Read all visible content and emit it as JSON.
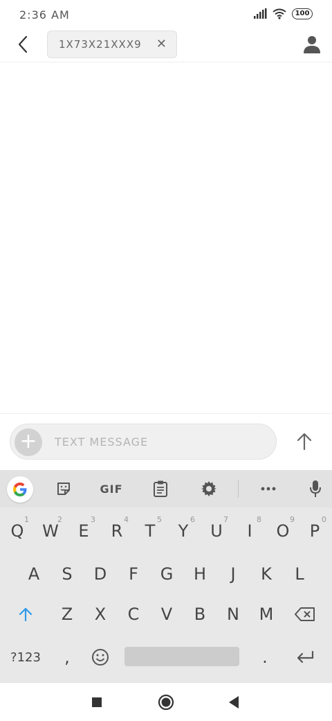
{
  "status_bar": {
    "time": "2:36 AM",
    "battery": "100",
    "icons": [
      "signal-icon",
      "wifi-icon",
      "battery-icon"
    ]
  },
  "header": {
    "recipient": "1X73X21XXX9",
    "icons": [
      "back-arrow-icon",
      "close-icon",
      "person-icon"
    ]
  },
  "compose": {
    "placeholder": "TEXT MESSAGE",
    "icons": [
      "plus-icon",
      "send-arrow-up-icon"
    ]
  },
  "keyboard": {
    "toolbar": {
      "gif_label": "GIF",
      "icons": [
        "google-g-icon",
        "sticker-icon",
        "clipboard-icon",
        "gear-icon",
        "more-dots-icon",
        "mic-icon"
      ]
    },
    "row1": [
      {
        "key": "Q",
        "hint": "1"
      },
      {
        "key": "W",
        "hint": "2"
      },
      {
        "key": "E",
        "hint": "3"
      },
      {
        "key": "R",
        "hint": "4"
      },
      {
        "key": "T",
        "hint": "5"
      },
      {
        "key": "Y",
        "hint": "6"
      },
      {
        "key": "U",
        "hint": "7"
      },
      {
        "key": "I",
        "hint": "8"
      },
      {
        "key": "O",
        "hint": "9"
      },
      {
        "key": "P",
        "hint": "0"
      }
    ],
    "row2": [
      "A",
      "S",
      "D",
      "F",
      "G",
      "H",
      "J",
      "K",
      "L"
    ],
    "row3": [
      "Z",
      "X",
      "C",
      "V",
      "B",
      "N",
      "M"
    ],
    "bottom": {
      "symbols": "?123",
      "comma": ",",
      "period": "."
    },
    "icons": [
      "shift-arrow-icon",
      "backspace-icon",
      "emoji-icon",
      "enter-icon"
    ],
    "accent_color": "#2f9ae8"
  },
  "nav_bar": {
    "icons": [
      "recents-square-icon",
      "home-circle-icon",
      "back-triangle-icon"
    ]
  }
}
